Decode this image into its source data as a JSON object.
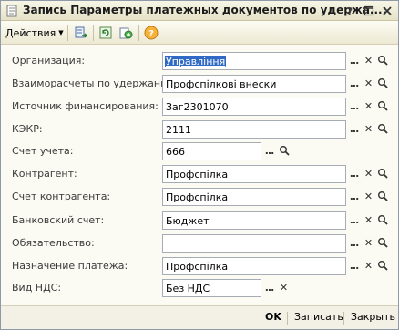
{
  "window": {
    "title": "Запись Параметры платежных документов по удержа...:"
  },
  "toolbar": {
    "actions_label": "Действия"
  },
  "fields": [
    {
      "label": "Организация:",
      "value": "Управління"
    },
    {
      "label": "Взаиморасчеты по удержанию:",
      "value": "Профспілкові внески"
    },
    {
      "label": "Источник финансирования:",
      "value": "Заг2301070"
    },
    {
      "label": "КЭКР:",
      "value": "2111"
    },
    {
      "label": "Счет учета:",
      "value": "666"
    },
    {
      "label": "Контрагент:",
      "value": "Профспілка"
    },
    {
      "label": "Счет контрагента:",
      "value": "Профспілка"
    },
    {
      "label": "Банковский счет:",
      "value": "Бюджет"
    },
    {
      "label": "Обязательство:",
      "value": ""
    },
    {
      "label": "Назначение платежа:",
      "value": "Профспілка"
    },
    {
      "label": "Вид НДС:",
      "value": "Без НДС"
    }
  ],
  "buttons": {
    "ok": "OK",
    "save": "Записать",
    "close": "Закрыть"
  },
  "icons": {
    "field_select": "ellipsis-icon",
    "field_clear": "clear-x-icon",
    "field_search": "magnifier-icon"
  }
}
